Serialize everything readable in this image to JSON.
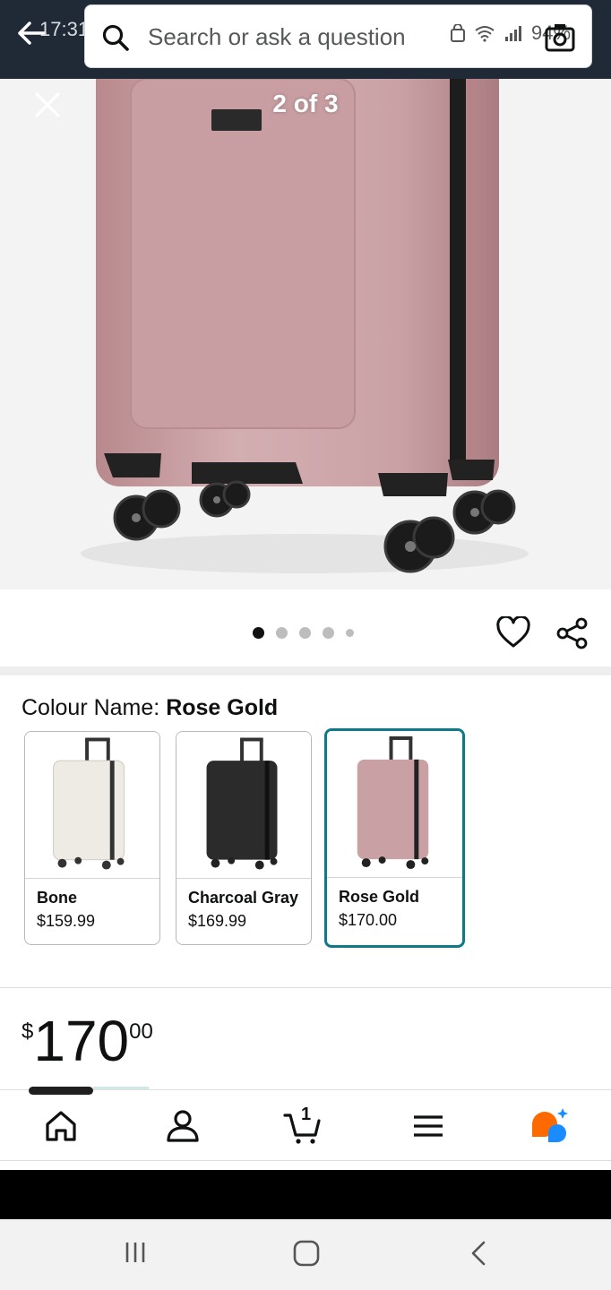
{
  "status_bar": {
    "time": "17:31",
    "voicemail": "ꝏ",
    "battery": "94%"
  },
  "search": {
    "placeholder": "Search or ask a question"
  },
  "gallery": {
    "counter": "2 of 3",
    "dot_count": 5,
    "active_dot": 0
  },
  "colour": {
    "label": "Colour Name:",
    "selected": "Rose Gold",
    "options": [
      {
        "name": "Bone",
        "price": "$159.99",
        "color": "#eeebe4"
      },
      {
        "name": "Charcoal Gray",
        "price": "$169.99",
        "color": "#2b2b2b"
      },
      {
        "name": "Rose Gold",
        "price": "$170.00",
        "color": "#c9a1a4"
      }
    ]
  },
  "price": {
    "symbol": "$",
    "whole": "170",
    "fraction": "00"
  },
  "bottom_nav": {
    "cart_count": "1"
  },
  "colors": {
    "topbar": "#1f2a36",
    "selected_border": "#0e7a89",
    "rufus_orange": "#ff6a00",
    "rufus_blue": "#1a8cff"
  }
}
